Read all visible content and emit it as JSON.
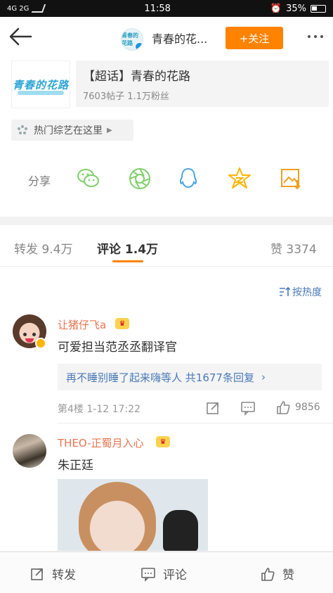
{
  "status_bar": {
    "signal_left": "4G  2G",
    "time": "11:58",
    "battery_percent": "35%"
  },
  "header": {
    "avatar_text": "青春的花路",
    "title": "青春的花...",
    "follow_label": "+关注"
  },
  "topic_card": {
    "thumbnail_text": "青春的花路",
    "name": "【超话】青春的花路",
    "stats": "7603帖子 1.1万粉丝"
  },
  "variety_tag": {
    "label": "热门综艺在这里"
  },
  "share": {
    "label": "分享",
    "icons": [
      "wechat-icon",
      "moments-icon",
      "qq-icon",
      "qzone-icon",
      "save-image-icon"
    ],
    "accent_color": "#ffb400",
    "green_color": "#7fcf6b",
    "blue_color": "#4aa6e0"
  },
  "tabs": {
    "repost": "转发 9.4万",
    "comment": "评论 1.4万",
    "like": "赞 3374",
    "active": "comment",
    "accent": "#ff8200"
  },
  "sort": {
    "label": "按热度"
  },
  "comments": [
    {
      "username": "让猪仔飞a",
      "text": "可爱担当范丞丞翻译官",
      "reply_summary": "再不睡别睡了起来嗨等人  共1677条回复",
      "meta": "第4楼  1-12 17:22",
      "likes": "9856"
    },
    {
      "username": "THEO-正蜀月入心",
      "text": "朱正廷"
    }
  ],
  "bottom_bar": {
    "repost": "转发",
    "comment": "评论",
    "like": "赞"
  }
}
